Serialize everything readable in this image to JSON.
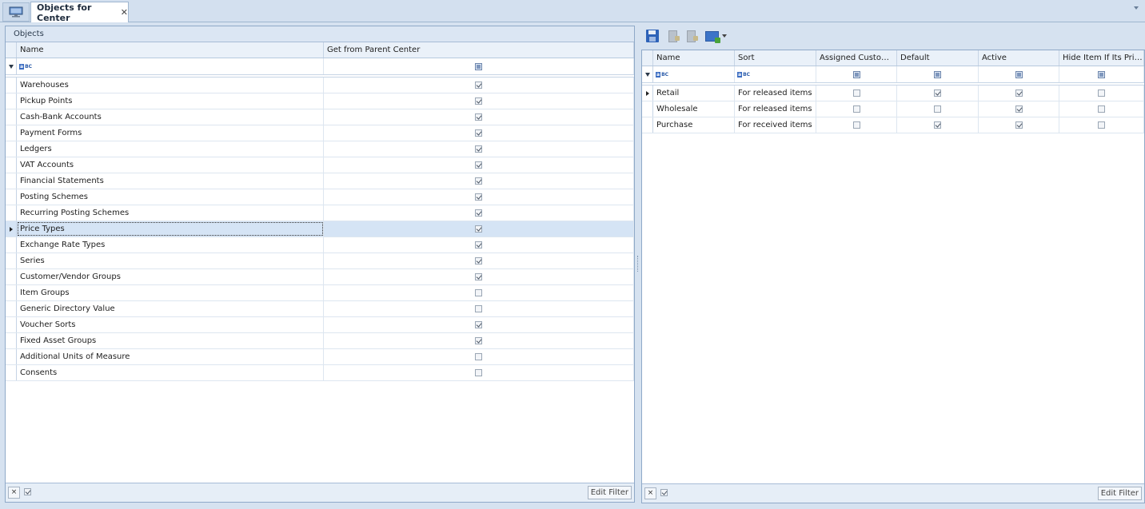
{
  "tabs": {
    "active_tab_label": "Objects for Center",
    "close_glyph": "✕"
  },
  "left": {
    "title": "Objects",
    "columns": {
      "name": "Name",
      "get": "Get from Parent Center"
    },
    "rows": [
      {
        "name": "Warehouses",
        "get": true
      },
      {
        "name": "Pickup Points",
        "get": true
      },
      {
        "name": "Cash-Bank Accounts",
        "get": true
      },
      {
        "name": "Payment Forms",
        "get": true
      },
      {
        "name": "Ledgers",
        "get": true
      },
      {
        "name": "VAT Accounts",
        "get": true
      },
      {
        "name": "Financial Statements",
        "get": true
      },
      {
        "name": "Posting Schemes",
        "get": true
      },
      {
        "name": "Recurring Posting Schemes",
        "get": true
      },
      {
        "name": "Price Types",
        "get": true,
        "selected": true
      },
      {
        "name": "Exchange Rate Types",
        "get": true
      },
      {
        "name": "Series",
        "get": true
      },
      {
        "name": "Customer/Vendor Groups",
        "get": true
      },
      {
        "name": "Item Groups",
        "get": false
      },
      {
        "name": "Generic Directory Value",
        "get": false
      },
      {
        "name": "Voucher Sorts",
        "get": true
      },
      {
        "name": "Fixed Asset Groups",
        "get": true
      },
      {
        "name": "Additional Units of Measure",
        "get": false
      },
      {
        "name": "Consents",
        "get": false
      }
    ],
    "footer": {
      "clear_glyph": "×",
      "edit_filter": "Edit Filter"
    }
  },
  "right": {
    "columns": {
      "name": "Name",
      "sort": "Sort",
      "assigned": "Assigned Custome...",
      "default": "Default",
      "active": "Active",
      "hide": "Hide Item If Its Pric..."
    },
    "rows": [
      {
        "name": "Retail",
        "sort": "For released items",
        "assigned": false,
        "default": true,
        "active": true,
        "hide": false
      },
      {
        "name": "Wholesale",
        "sort": "For released items",
        "assigned": false,
        "default": false,
        "active": true,
        "hide": false
      },
      {
        "name": "Purchase",
        "sort": "For received items",
        "assigned": false,
        "default": true,
        "active": true,
        "hide": false
      }
    ],
    "footer": {
      "clear_glyph": "×",
      "edit_filter": "Edit Filter"
    }
  },
  "icons": [
    "monitor-icon",
    "save-icon",
    "document-import-icon",
    "document-export-icon",
    "grid-view-icon"
  ]
}
